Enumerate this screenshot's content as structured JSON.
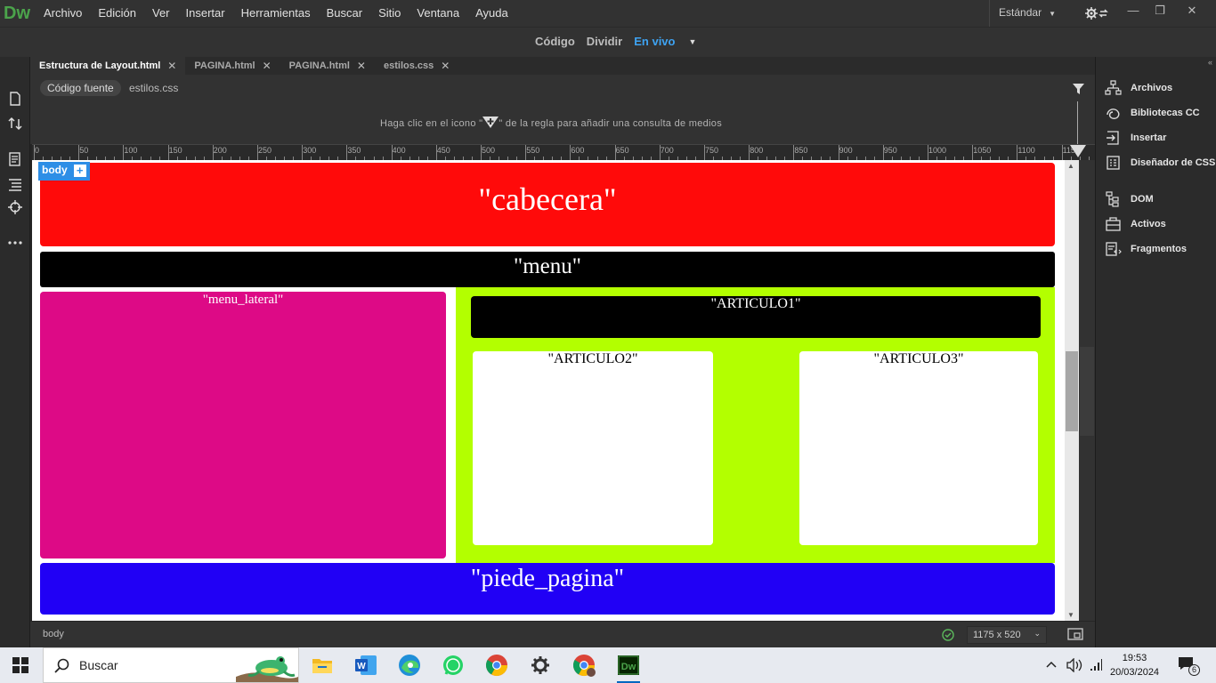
{
  "app": {
    "logo": "Dw"
  },
  "menu": [
    "Archivo",
    "Edición",
    "Ver",
    "Insertar",
    "Herramientas",
    "Buscar",
    "Sitio",
    "Ventana",
    "Ayuda"
  ],
  "workspace": {
    "label": "Estándar"
  },
  "view": {
    "code": "Código",
    "split": "Dividir",
    "live": "En vivo"
  },
  "tabs": [
    {
      "label": "Estructura de Layout.html"
    },
    {
      "label": "PAGINA.html"
    },
    {
      "label": "PAGINA.html"
    },
    {
      "label": "estilos.css"
    }
  ],
  "related": {
    "source": "Código fuente",
    "css": "estilos.css"
  },
  "media_query": {
    "before": "Haga clic en el icono \"",
    "after": "\" de la regla para añadir una consulta de medios"
  },
  "ruler": [
    "0",
    "50",
    "100",
    "150",
    "200",
    "250",
    "300",
    "350",
    "400",
    "450",
    "500",
    "550",
    "600",
    "650",
    "700",
    "750",
    "800",
    "850",
    "900",
    "950",
    "1000",
    "1050",
    "1100",
    "115"
  ],
  "canvas": {
    "body_tag": "body",
    "plus": "+",
    "cabecera": "\"cabecera\"",
    "menu": "\"menu\"",
    "menu_lateral": "\"menu_lateral\"",
    "articulo1": "\"ARTICULO1\"",
    "articulo2": "\"ARTICULO2\"",
    "articulo3": "\"ARTICULO3\"",
    "piede_pagina": "\"piede_pagina\"",
    "colors": {
      "cabecera": "#ff0a0a",
      "menu": "#000000",
      "menu_lateral": "#dd0a86",
      "contenido": "#b3ff00",
      "piede_pagina": "#2100f5"
    }
  },
  "status": {
    "tag": "body",
    "size": "1175 x 520"
  },
  "right_panel": {
    "items": [
      {
        "label": "Archivos",
        "icon": "files-icon"
      },
      {
        "label": "Bibliotecas CC",
        "icon": "cc-libraries-icon"
      },
      {
        "label": "Insertar",
        "icon": "insert-icon"
      },
      {
        "label": "Diseñador de CSS",
        "icon": "css-designer-icon"
      },
      {
        "label": "DOM",
        "icon": "dom-icon"
      },
      {
        "label": "Activos",
        "icon": "assets-icon"
      },
      {
        "label": "Fragmentos",
        "icon": "snippets-icon"
      }
    ]
  },
  "taskbar": {
    "search": "Buscar",
    "time": "19:53",
    "date": "20/03/2024",
    "notifications": "6"
  }
}
